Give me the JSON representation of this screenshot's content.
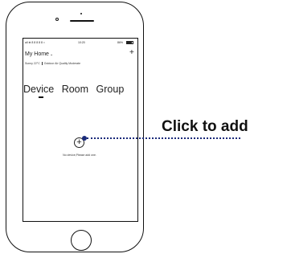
{
  "status_bar": {
    "carrier": "all ⊕ 8 8 8 8 8 ≈",
    "time": "10:20",
    "battery": "86%"
  },
  "header": {
    "home_title": "My Home",
    "home_chevron": "⌄",
    "add_symbol": "+"
  },
  "weather": {
    "temperature": "Sunny 22°C",
    "air_quality": "Outdoor Air Quality Moderate"
  },
  "tabs": [
    {
      "label": "Device",
      "selected": true
    },
    {
      "label": "Room",
      "selected": false
    },
    {
      "label": "Group",
      "selected": false
    }
  ],
  "empty_state": {
    "add_symbol": "+",
    "message": "No device,Please add one."
  },
  "callout": {
    "label": "Click to add",
    "color": "#1a2a7a"
  }
}
